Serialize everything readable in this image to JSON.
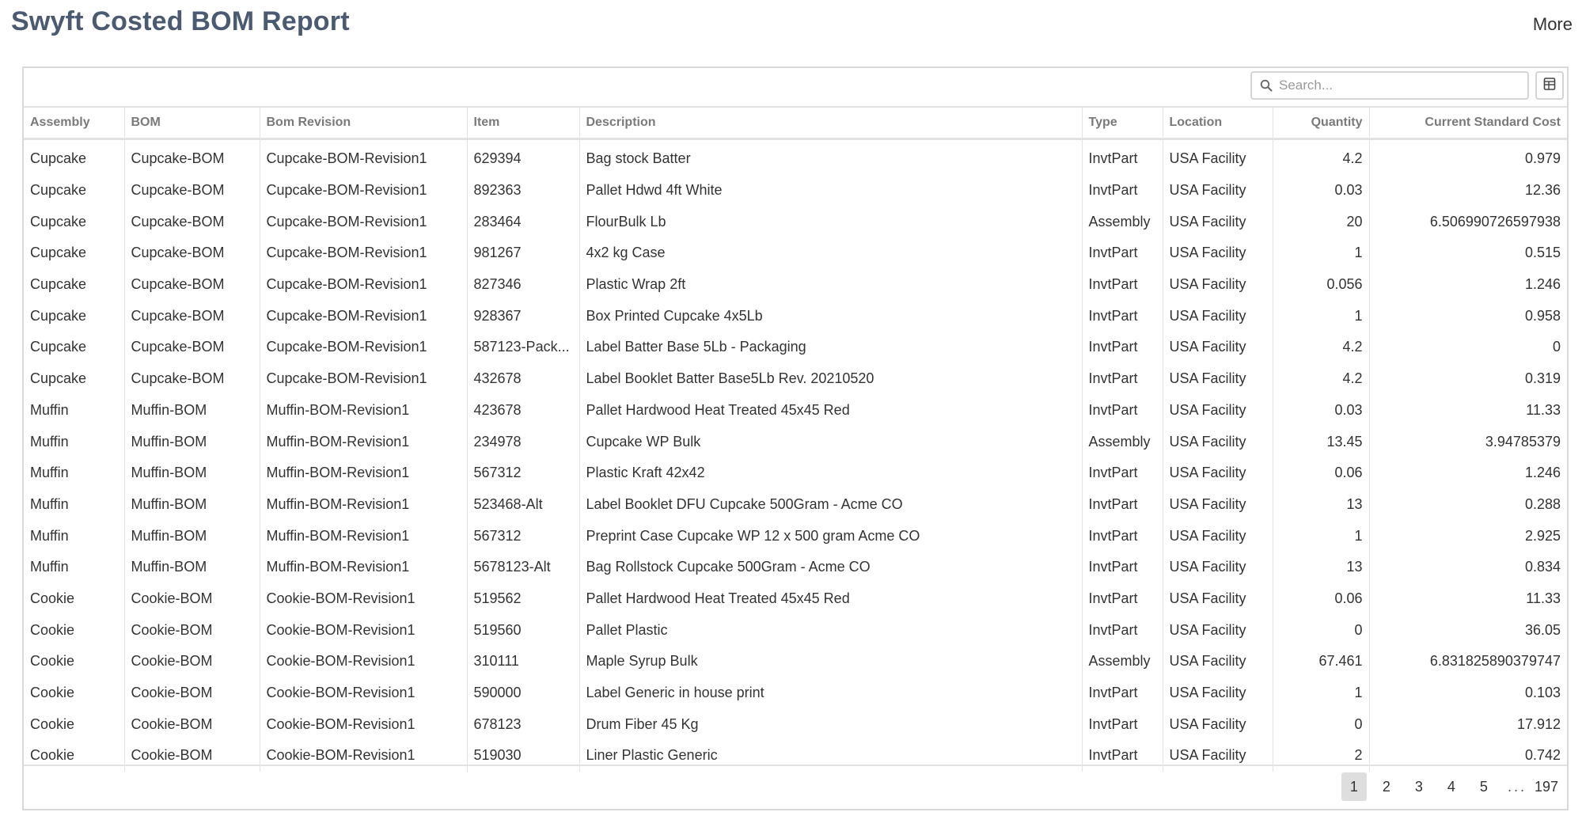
{
  "header": {
    "title": "Swyft Costed BOM Report",
    "more_label": "More"
  },
  "toolbar": {
    "search_placeholder": "Search...",
    "search_icon": "search-icon",
    "export_icon": "spreadsheet-export-icon"
  },
  "table": {
    "columns": [
      "Assembly",
      "BOM",
      "Bom Revision",
      "Item",
      "Description",
      "Type",
      "Location",
      "Quantity",
      "Current Standard Cost"
    ],
    "rows": [
      [
        "Cupcake",
        "Cupcake-BOM",
        "Cupcake-BOM-Revision1",
        "629394",
        "Bag stock Batter",
        "InvtPart",
        "USA Facility",
        "4.2",
        "0.979"
      ],
      [
        "Cupcake",
        "Cupcake-BOM",
        "Cupcake-BOM-Revision1",
        "892363",
        "Pallet Hdwd 4ft White",
        "InvtPart",
        "USA Facility",
        "0.03",
        "12.36"
      ],
      [
        "Cupcake",
        "Cupcake-BOM",
        "Cupcake-BOM-Revision1",
        "283464",
        "FlourBulk Lb",
        "Assembly",
        "USA Facility",
        "20",
        "6.506990726597938"
      ],
      [
        "Cupcake",
        "Cupcake-BOM",
        "Cupcake-BOM-Revision1",
        "981267",
        "4x2 kg Case",
        "InvtPart",
        "USA Facility",
        "1",
        "0.515"
      ],
      [
        "Cupcake",
        "Cupcake-BOM",
        "Cupcake-BOM-Revision1",
        "827346",
        "Plastic Wrap 2ft",
        "InvtPart",
        "USA Facility",
        "0.056",
        "1.246"
      ],
      [
        "Cupcake",
        "Cupcake-BOM",
        "Cupcake-BOM-Revision1",
        "928367",
        "Box Printed Cupcake 4x5Lb",
        "InvtPart",
        "USA Facility",
        "1",
        "0.958"
      ],
      [
        "Cupcake",
        "Cupcake-BOM",
        "Cupcake-BOM-Revision1",
        "587123-Pack...",
        "Label Batter Base 5Lb - Packaging",
        "InvtPart",
        "USA Facility",
        "4.2",
        "0"
      ],
      [
        "Cupcake",
        "Cupcake-BOM",
        "Cupcake-BOM-Revision1",
        "432678",
        "Label Booklet Batter Base5Lb Rev. 20210520",
        "InvtPart",
        "USA Facility",
        "4.2",
        "0.319"
      ],
      [
        "Muffin",
        "Muffin-BOM",
        "Muffin-BOM-Revision1",
        "423678",
        "Pallet Hardwood Heat Treated 45x45 Red",
        "InvtPart",
        "USA Facility",
        "0.03",
        "11.33"
      ],
      [
        "Muffin",
        "Muffin-BOM",
        "Muffin-BOM-Revision1",
        "234978",
        "Cupcake WP Bulk",
        "Assembly",
        "USA Facility",
        "13.45",
        "3.94785379"
      ],
      [
        "Muffin",
        "Muffin-BOM",
        "Muffin-BOM-Revision1",
        "567312",
        "Plastic Kraft 42x42",
        "InvtPart",
        "USA Facility",
        "0.06",
        "1.246"
      ],
      [
        "Muffin",
        "Muffin-BOM",
        "Muffin-BOM-Revision1",
        "523468-Alt",
        "Label Booklet DFU Cupcake 500Gram - Acme CO",
        "InvtPart",
        "USA Facility",
        "13",
        "0.288"
      ],
      [
        "Muffin",
        "Muffin-BOM",
        "Muffin-BOM-Revision1",
        "567312",
        "Preprint Case Cupcake WP 12 x 500 gram Acme CO",
        "InvtPart",
        "USA Facility",
        "1",
        "2.925"
      ],
      [
        "Muffin",
        "Muffin-BOM",
        "Muffin-BOM-Revision1",
        "5678123-Alt",
        "Bag Rollstock Cupcake 500Gram - Acme CO",
        "InvtPart",
        "USA Facility",
        "13",
        "0.834"
      ],
      [
        "Cookie",
        "Cookie-BOM",
        "Cookie-BOM-Revision1",
        "519562",
        "Pallet Hardwood Heat Treated 45x45 Red",
        "InvtPart",
        "USA Facility",
        "0.06",
        "11.33"
      ],
      [
        "Cookie",
        "Cookie-BOM",
        "Cookie-BOM-Revision1",
        "519560",
        "Pallet Plastic",
        "InvtPart",
        "USA Facility",
        "0",
        "36.05"
      ],
      [
        "Cookie",
        "Cookie-BOM",
        "Cookie-BOM-Revision1",
        "310111",
        "Maple Syrup Bulk",
        "Assembly",
        "USA Facility",
        "67.461",
        "6.831825890379747"
      ],
      [
        "Cookie",
        "Cookie-BOM",
        "Cookie-BOM-Revision1",
        "590000",
        "Label Generic in house print",
        "InvtPart",
        "USA Facility",
        "1",
        "0.103"
      ],
      [
        "Cookie",
        "Cookie-BOM",
        "Cookie-BOM-Revision1",
        "678123",
        "Drum Fiber 45 Kg",
        "InvtPart",
        "USA Facility",
        "0",
        "17.912"
      ],
      [
        "Cookie",
        "Cookie-BOM",
        "Cookie-BOM-Revision1",
        "519030",
        "Liner Plastic Generic",
        "InvtPart",
        "USA Facility",
        "2",
        "0.742"
      ]
    ]
  },
  "pagination": {
    "pages": [
      "1",
      "2",
      "3",
      "4",
      "5"
    ],
    "current": "1",
    "ellipsis": "...",
    "last": "197"
  }
}
